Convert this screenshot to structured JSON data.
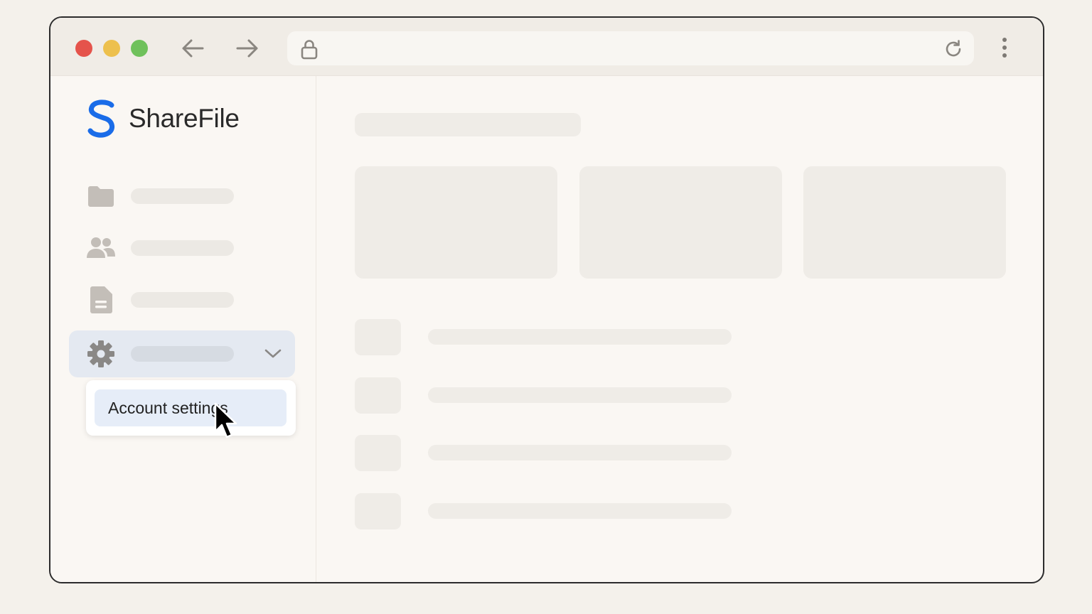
{
  "app": {
    "name": "ShareFile",
    "brand_color": "#1a6ce8"
  },
  "browser": {
    "traffic_lights": [
      "close",
      "minimize",
      "maximize"
    ],
    "icons": [
      "back-arrow-icon",
      "forward-arrow-icon",
      "lock-icon",
      "reload-icon",
      "more-vertical-icon"
    ]
  },
  "sidebar": {
    "items": [
      {
        "icon": "folder-icon",
        "label": ""
      },
      {
        "icon": "people-icon",
        "label": ""
      },
      {
        "icon": "document-icon",
        "label": ""
      },
      {
        "icon": "gear-icon",
        "label": "",
        "expanded": true
      }
    ],
    "settings_menu": {
      "items": [
        {
          "label": "Account settings",
          "hovered": true
        }
      ]
    }
  },
  "main": {
    "loading_placeholders": true
  }
}
